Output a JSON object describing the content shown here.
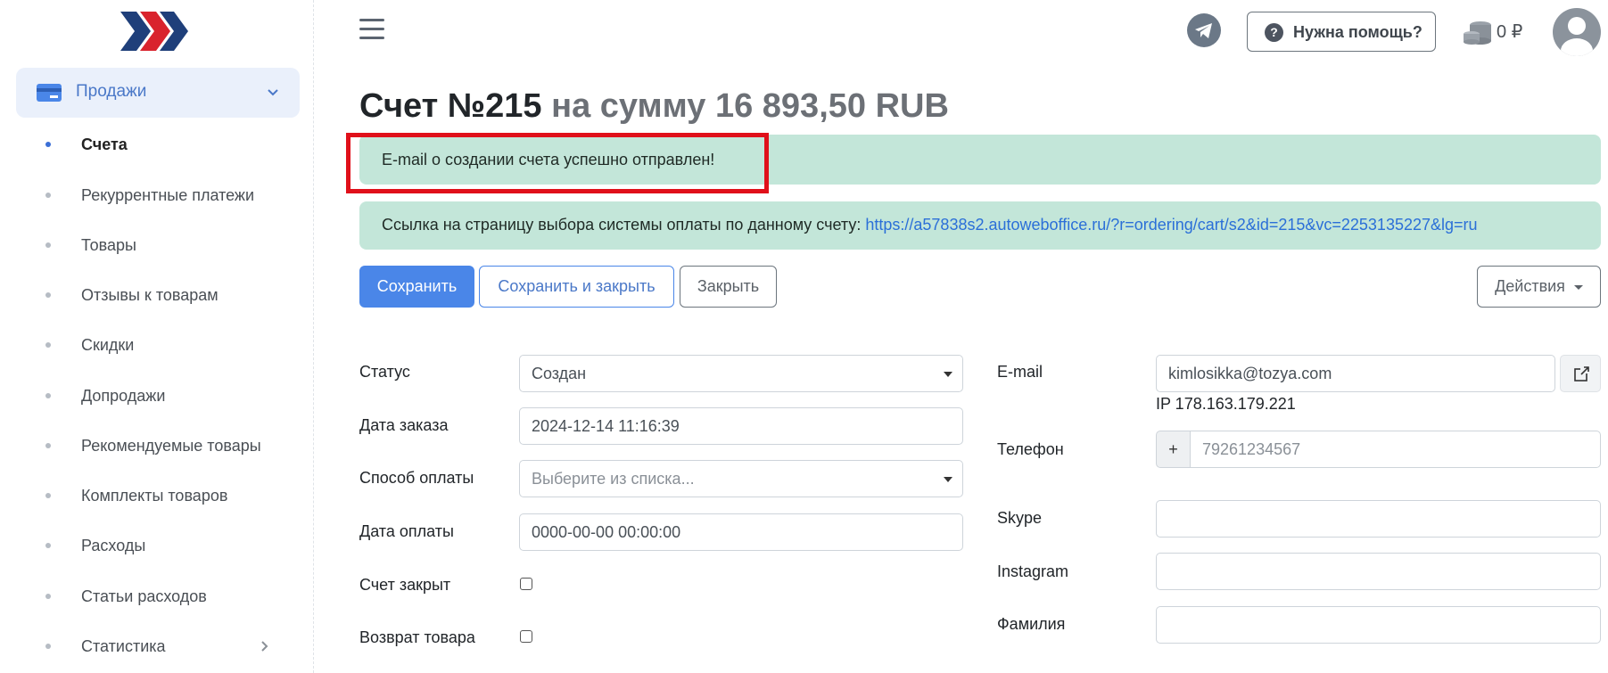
{
  "sidebar": {
    "section_label": "Продажи",
    "items": [
      {
        "label": "Счета",
        "active": true
      },
      {
        "label": "Рекуррентные платежи"
      },
      {
        "label": "Товары"
      },
      {
        "label": "Отзывы к товарам"
      },
      {
        "label": "Скидки"
      },
      {
        "label": "Допродажи"
      },
      {
        "label": "Рекомендуемые товары"
      },
      {
        "label": "Комплекты товаров"
      },
      {
        "label": "Расходы"
      },
      {
        "label": "Статьи расходов"
      },
      {
        "label": "Статистика",
        "has_submenu": true
      }
    ]
  },
  "header": {
    "help_label": "Нужна помощь?",
    "balance": "0 ₽"
  },
  "page": {
    "title_number": "Счет №215",
    "title_sum": "на сумму 16 893,50 RUB"
  },
  "alerts": {
    "email_sent": "E-mail о создании счета успешно отправлен!",
    "payment_link_label": "Ссылка на страницу выбора системы оплаты по данному счету:",
    "payment_link_url": "https://a57838s2.autoweboffice.ru/?r=ordering/cart/s2&id=215&vc=2253135227&lg=ru"
  },
  "toolbar": {
    "save_label": "Сохранить",
    "save_close_label": "Сохранить и закрыть",
    "close_label": "Закрыть",
    "actions_label": "Действия"
  },
  "form_left": {
    "status_label": "Статус",
    "status_value": "Создан",
    "order_date_label": "Дата заказа",
    "order_date_value": "2024-12-14 11:16:39",
    "payment_method_label": "Способ оплаты",
    "payment_method_placeholder": "Выберите из списка...",
    "payment_date_label": "Дата оплаты",
    "payment_date_value": "0000-00-00 00:00:00",
    "closed_label": "Счет закрыт",
    "return_label": "Возврат товара"
  },
  "form_right": {
    "email_label": "E-mail",
    "email_value": "kimlosikka@tozya.com",
    "ip_text": "IP 178.163.179.221",
    "phone_label": "Телефон",
    "phone_prefix": "+",
    "phone_placeholder": "79261234567",
    "skype_label": "Skype",
    "instagram_label": "Instagram",
    "surname_label": "Фамилия"
  },
  "colors": {
    "accent": "#4a86e8",
    "alert_bg": "#c3e6d9",
    "highlight_box": "#e0101a"
  }
}
